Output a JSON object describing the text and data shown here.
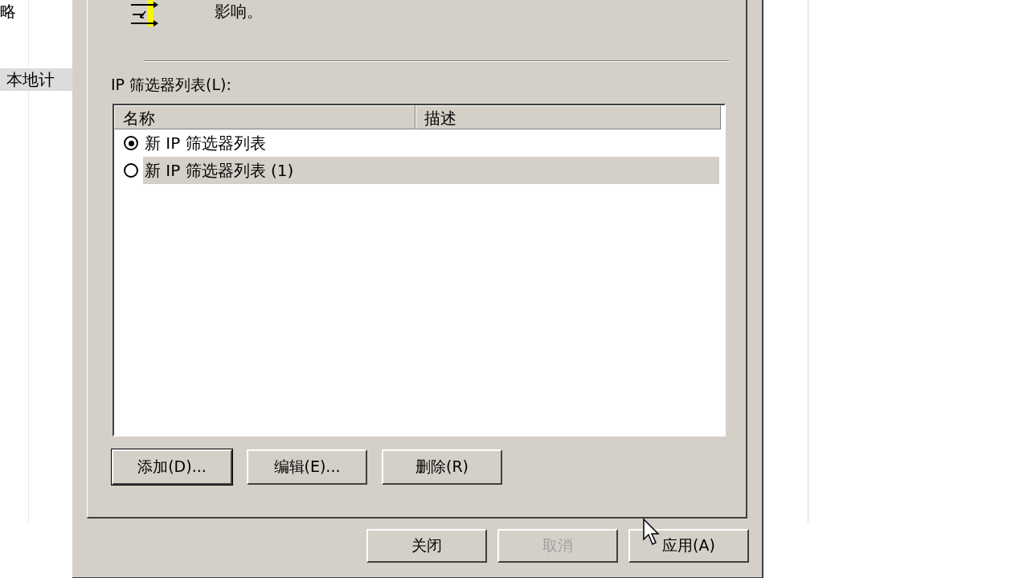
{
  "left_pane": {
    "items": [
      {
        "label": "略",
        "selected": false
      },
      {
        "label": "本地计",
        "selected": true
      }
    ]
  },
  "dialog": {
    "intro_text": "影响。",
    "list_label": "IP 筛选器列表(L):",
    "list": {
      "columns": [
        "名称",
        "描述"
      ],
      "rows": [
        {
          "name": "新 IP 筛选器列表",
          "selected": true
        },
        {
          "name": "新 IP 筛选器列表 (1)",
          "selected": false
        }
      ]
    },
    "list_buttons": [
      {
        "label": "添加(D)...",
        "default": true
      },
      {
        "label": "编辑(E)...",
        "default": false
      },
      {
        "label": "删除(R)",
        "default": false
      }
    ],
    "footer_buttons": [
      {
        "label": "关闭",
        "disabled": false
      },
      {
        "label": "取消",
        "disabled": true
      },
      {
        "label": "应用(A)",
        "disabled": false
      }
    ]
  }
}
